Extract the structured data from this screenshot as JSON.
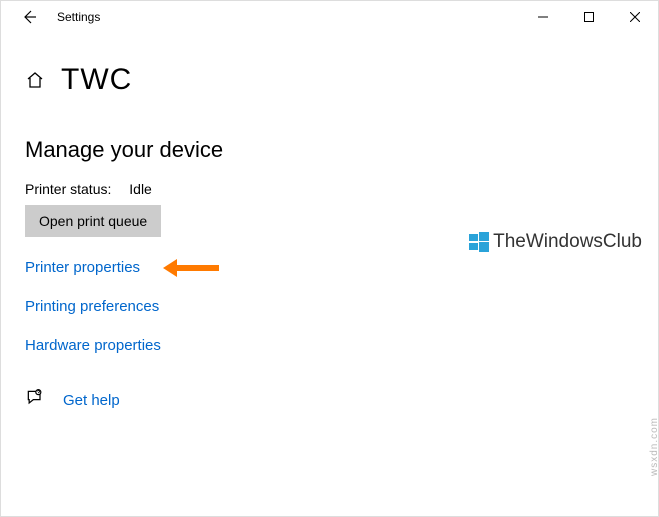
{
  "window": {
    "title": "Settings"
  },
  "header": {
    "page_title": "TWC"
  },
  "section": {
    "heading": "Manage your device",
    "status_label": "Printer status:",
    "status_value": "Idle",
    "queue_button": "Open print queue"
  },
  "links": {
    "printer_properties": "Printer properties",
    "printing_preferences": "Printing preferences",
    "hardware_properties": "Hardware properties",
    "get_help": "Get help"
  },
  "watermark": {
    "text": "TheWindowsClub",
    "side": "wsxdn.com"
  }
}
